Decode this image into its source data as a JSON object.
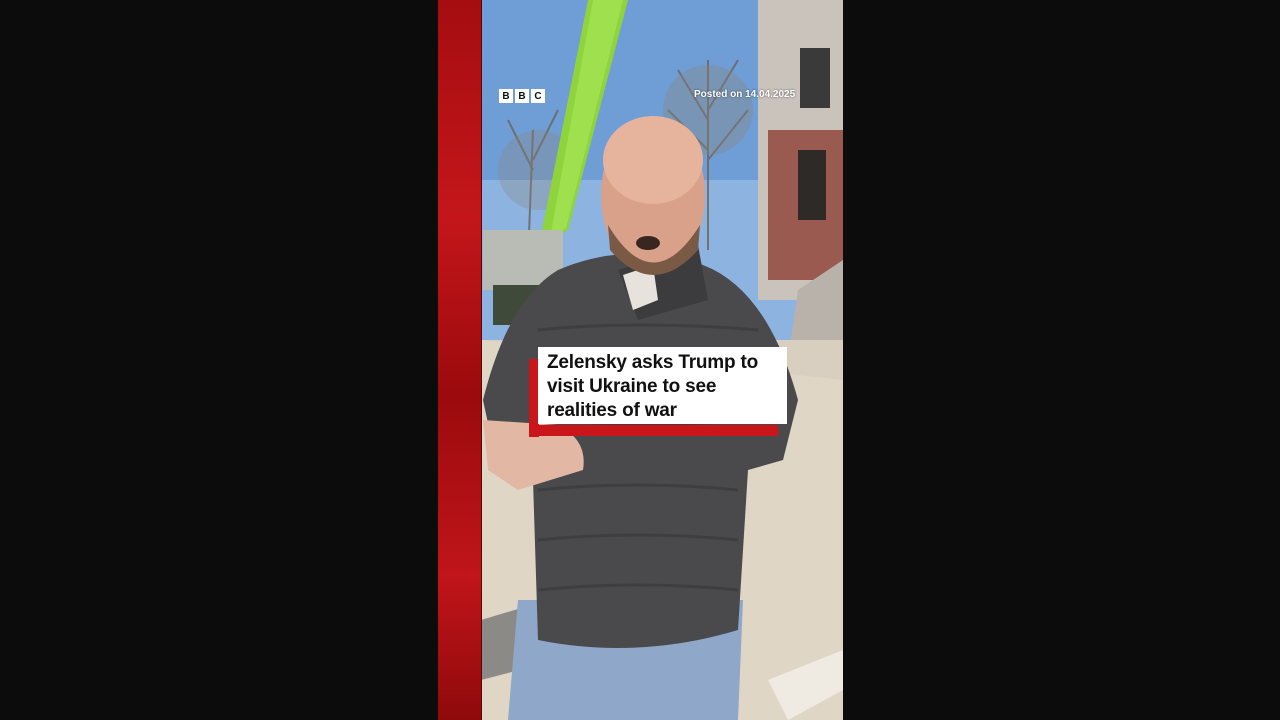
{
  "video": {
    "logo_letters": [
      "B",
      "B",
      "C"
    ],
    "posted_text": "Posted on 14.04.2025",
    "headline": "Zelensky asks Trump to visit Ukraine to see realities of war"
  },
  "colors": {
    "page_background": "#0c0c0c",
    "brand_red": "#c8161b",
    "sky": "#7fa9d8",
    "crane_green": "#8fd43c",
    "jacket": "#4a4a4c"
  },
  "icons": {
    "logo": "bbc-logo-icon"
  }
}
